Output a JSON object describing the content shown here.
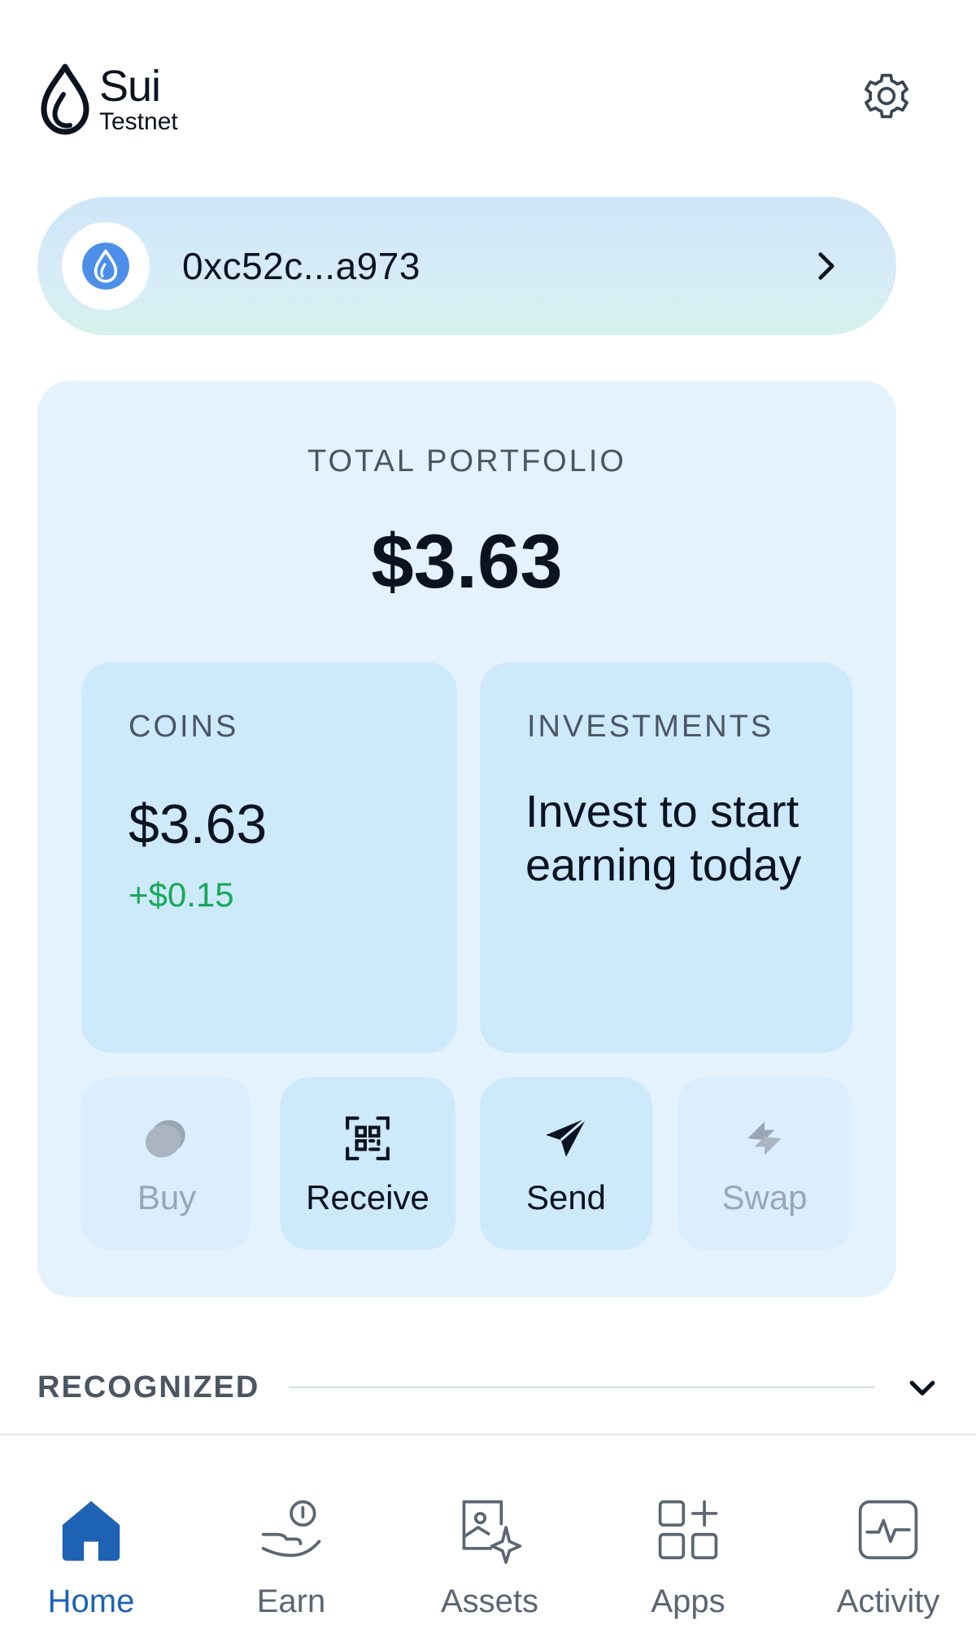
{
  "header": {
    "logo_name": "Sui",
    "logo_network": "Testnet"
  },
  "account": {
    "address": "0xc52c...a973"
  },
  "portfolio": {
    "label": "TOTAL PORTFOLIO",
    "total": "$3.63",
    "coins": {
      "label": "COINS",
      "value": "$3.63",
      "change": "+$0.15"
    },
    "investments": {
      "label": "INVESTMENTS",
      "text": "Invest to start earning today"
    },
    "actions": [
      {
        "label": "Buy",
        "enabled": false
      },
      {
        "label": "Receive",
        "enabled": true
      },
      {
        "label": "Send",
        "enabled": true
      },
      {
        "label": "Swap",
        "enabled": false
      }
    ]
  },
  "recognized": {
    "label": "RECOGNIZED"
  },
  "nav": [
    {
      "label": "Home",
      "icon": "home-icon",
      "active": true
    },
    {
      "label": "Earn",
      "icon": "earn-icon",
      "active": false
    },
    {
      "label": "Assets",
      "icon": "assets-icon",
      "active": false
    },
    {
      "label": "Apps",
      "icon": "apps-icon",
      "active": false
    },
    {
      "label": "Activity",
      "icon": "activity-icon",
      "active": false
    }
  ],
  "colors": {
    "accent": "#1e62b4",
    "positive": "#18a957",
    "card_bg": "#e4f2fe",
    "subcard_bg": "#cde9fc"
  }
}
